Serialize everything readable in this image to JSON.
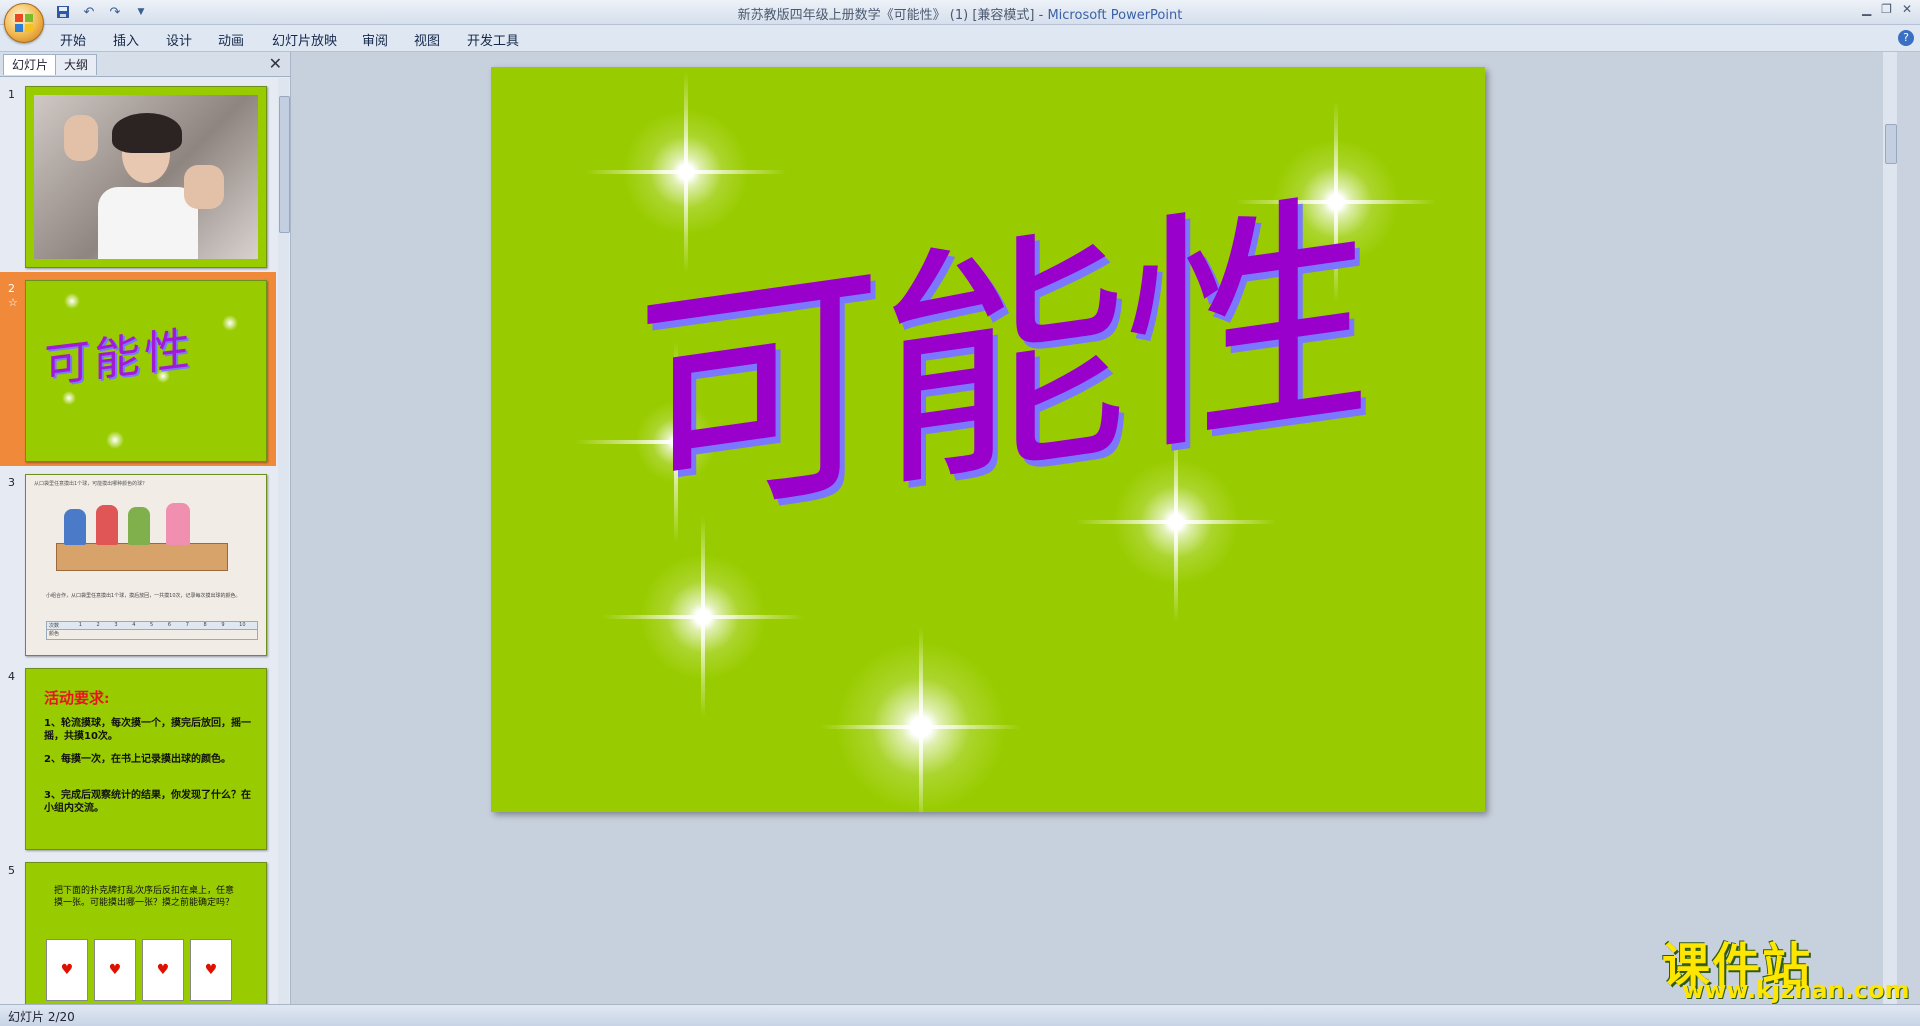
{
  "window": {
    "doc_title": "新苏教版四年级上册数学《可能性》 (1) [兼容模式]",
    "separator": " - ",
    "app_name": "Microsoft PowerPoint"
  },
  "ribbon": {
    "tabs": [
      "开始",
      "插入",
      "设计",
      "动画",
      "幻灯片放映",
      "审阅",
      "视图",
      "开发工具"
    ]
  },
  "panel": {
    "tabs": [
      "幻灯片",
      "大纲"
    ],
    "close": "✕"
  },
  "thumbnails": [
    {
      "num": "1",
      "kind": "photo"
    },
    {
      "num": "2",
      "sub": "☆",
      "title": "可能性",
      "selected": true
    },
    {
      "num": "3",
      "kind": "textbook",
      "text1": "从口袋里任意摸出1个球，可能摸出哪种颜色的球？",
      "text2": "小组合作，从口袋里任意摸出1个球，摸后放回，一共摸10次，记录每次摸出球的颜色。",
      "header_row": [
        "次数",
        "1",
        "2",
        "3",
        "4",
        "5",
        "6",
        "7",
        "8",
        "9",
        "10"
      ],
      "data_row_label": "颜色"
    },
    {
      "num": "4",
      "heading": "活动要求:",
      "items": [
        "1、轮流摸球，每次摸一个，摸完后放回，摇一摇，共摸10次。",
        "2、每摸一次，在书上记录摸出球的颜色。",
        "3、完成后观察统计的结果，你发现了什么？在小组内交流。"
      ]
    },
    {
      "num": "5",
      "text": "把下面的扑克牌打乱次序后反扣在桌上，任意摸一张。可能摸出哪一张？摸之前能确定吗？"
    }
  ],
  "slide": {
    "title": "可能性"
  },
  "status": {
    "slide_indicator": "幻灯片 2/20"
  },
  "watermark": {
    "main": "课件站",
    "url": "www.kjzhan.com"
  },
  "colors": {
    "slide_bg": "#99cc00",
    "title": "#9900cc",
    "title_shadow": "#7a78ff",
    "selected_thumb": "#f08a3a",
    "watermark": "#ffe600"
  }
}
